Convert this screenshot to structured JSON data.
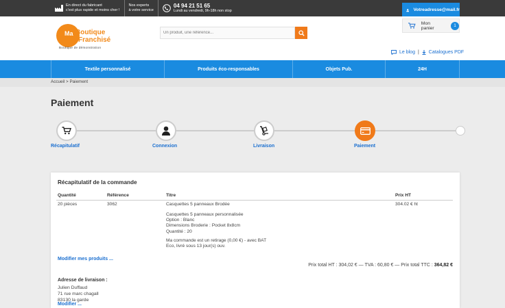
{
  "topbar": {
    "fabricant_line1": "En direct du fabricant",
    "fabricant_line2": "c'est plus rapide et moins cher !",
    "experts_line1": "Nos experts",
    "experts_line2": "à votre service",
    "phone": "04 94 21 51 65",
    "hours": "Lundi au vendredi, 9h-18h non stop",
    "account_email": "Votreadresse@mail.fr"
  },
  "header": {
    "logo_ma": "Ma",
    "logo_boutique": "Boutique",
    "logo_franchise": "Franchisé",
    "logo_tagline": "Boutique de démonstration",
    "search_placeholder": "Un produit, une référence...",
    "cart_label": "Mon panier",
    "cart_count": "1",
    "link_blog": "Le blog",
    "link_catalogues": "Catalogues PDF"
  },
  "nav": {
    "items": [
      {
        "label": "Textile personnalisé"
      },
      {
        "label": "Produits éco-responsables"
      },
      {
        "label": "Objets Pub."
      },
      {
        "label": "24H"
      }
    ]
  },
  "breadcrumb": {
    "text": "Accueil > Paiement"
  },
  "page_title": "Paiement",
  "steps": [
    {
      "label": "Récapitulatif",
      "icon": "cart-icon"
    },
    {
      "label": "Connexion",
      "icon": "user-icon"
    },
    {
      "label": "Livraison",
      "icon": "hand-truck-icon"
    },
    {
      "label": "Paiement",
      "icon": "credit-card-icon",
      "active": true
    }
  ],
  "recap": {
    "title": "Récapitulatif de la commande",
    "headers": {
      "qty": "Quantité",
      "ref": "Référence",
      "title": "Titre",
      "price": "Prix HT"
    },
    "row": {
      "qty": "20 pièces",
      "ref": "3062",
      "title": "Casquettes 5 panneaux Brodée",
      "price": "304.02 € ht",
      "details": [
        "Casquettes 5 panneaux personnalisée",
        "Option : Blanc",
        "Dimensions Broderie : Pocket 8x8cm",
        "Quantité : 20"
      ],
      "notes": [
        "Ma commande est un retirage (0,00 €) - avec BAT",
        "Eco, livré sous 13 jour(s) ouv."
      ]
    },
    "modify_products": "Modifier mes produits ...",
    "totals_prefix": "Prix total HT : 304,02 € — TVA : 60,80 € — Prix total TTC : ",
    "total_ttc": "364,82 €",
    "address_title": "Adresse de livraison :",
    "address_lines": [
      "Julien Duffaud",
      "71 rue marc chagall",
      "83130 la garde"
    ],
    "modify_address": "Modifier ..."
  },
  "colors": {
    "primary": "#1a8be0",
    "accent": "#f07a1a",
    "topbar": "#3a3a3a"
  }
}
